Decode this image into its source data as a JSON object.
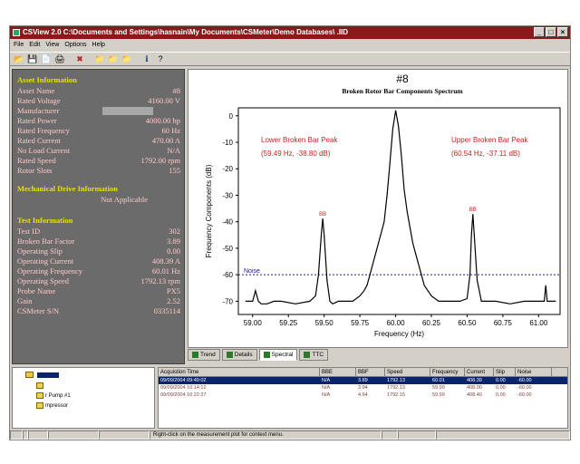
{
  "window": {
    "title": "CSView 2.0  C:\\Documents and Settings\\hasnain\\My Documents\\CSMeter\\Demo Databases\\        .IID",
    "buttons": [
      "_",
      "□",
      "×"
    ]
  },
  "menu": [
    "File",
    "Edit",
    "View",
    "Options",
    "Help"
  ],
  "toolbar": {
    "icons": [
      "open-folder-icon",
      "save-icon",
      "copy-icon",
      "print-icon",
      "delete-icon",
      "folder-yellow-icon",
      "folder-purple-icon",
      "folder-dark-icon",
      "info-icon",
      "help-icon"
    ],
    "glyphs": [
      "📂",
      "💾",
      "📄",
      "🖨",
      "✖",
      "📁",
      "📁",
      "📁",
      "ℹ",
      "?"
    ]
  },
  "asset": {
    "heading": "Asset Information",
    "rows": [
      {
        "label": "Asset Name",
        "value": "#8"
      },
      {
        "label": "Rated Voltage",
        "value": "4160.00 V"
      },
      {
        "label": "Manufacturer",
        "value": ""
      },
      {
        "label": "Rated Power",
        "value": "4000.00 hp"
      },
      {
        "label": "Rated Frequency",
        "value": "60 Hz"
      },
      {
        "label": "Rated Current",
        "value": "470.00 A"
      },
      {
        "label": "No Load Current",
        "value": "N/A"
      },
      {
        "label": "Rated Speed",
        "value": "1792.00 rpm"
      },
      {
        "label": "Rotor Slots",
        "value": "155"
      }
    ]
  },
  "drive": {
    "heading": "Mechanical Drive Information",
    "value": "Not Applicable"
  },
  "test": {
    "heading": "Test Information",
    "rows": [
      {
        "label": "Test ID",
        "value": "302"
      },
      {
        "label": "Broken Bar Factor",
        "value": "3.89"
      },
      {
        "label": "Operating Slip",
        "value": "0.00"
      },
      {
        "label": "Operating Current",
        "value": "408.39 A"
      },
      {
        "label": "Operating Frequency",
        "value": "60.01 Hz"
      },
      {
        "label": "Operating Speed",
        "value": "1792.13 rpm"
      },
      {
        "label": "Probe Name",
        "value": "PX5"
      },
      {
        "label": "Gain",
        "value": "2.52"
      },
      {
        "label": "CSMeter S/N",
        "value": "0335114"
      }
    ]
  },
  "chart_data": {
    "type": "line",
    "title": "#8",
    "subtitle": "Broken Rotor Bar Components Spectrum",
    "xlabel": "Frequency (Hz)",
    "ylabel": "Frequency Components (dB)",
    "xlim": [
      58.9,
      61.15
    ],
    "ylim": [
      -75,
      3
    ],
    "xticks": [
      59.0,
      59.25,
      59.5,
      59.75,
      60.0,
      60.25,
      60.5,
      60.75,
      61.0
    ],
    "xtick_labels": [
      "59.00",
      "59.25",
      "59.50",
      "59.75",
      "60.00",
      "60.25",
      "60.50",
      "60.75",
      "61.00"
    ],
    "yticks": [
      0,
      -10,
      -20,
      -30,
      -40,
      -50,
      -60,
      -70
    ],
    "grid": false,
    "noise": {
      "label": "Noise",
      "value": -60,
      "color": "#1a1aa0"
    },
    "annotations": [
      {
        "label": "Lower Broken Bar Peak",
        "detail": "(59.49 Hz, -38.80 dB)"
      },
      {
        "label": "Upper Broken Bar Peak",
        "detail": "(60.54 Hz, -37.11 dB)"
      }
    ],
    "peak_markers": [
      {
        "label": "BB",
        "x": 59.49,
        "y": -38.8
      },
      {
        "label": "BB",
        "x": 60.54,
        "y": -37.11
      }
    ],
    "label_color": "#cc2020",
    "series": [
      {
        "x": [
          58.95,
          59.0,
          59.02,
          59.04,
          59.06,
          59.1,
          59.15,
          59.2,
          59.3,
          59.4,
          59.44,
          59.46,
          59.48,
          59.49,
          59.5,
          59.52,
          59.54,
          59.56,
          59.6,
          59.65,
          59.7,
          59.75,
          59.78,
          59.8,
          59.82,
          59.84,
          59.86,
          59.88,
          59.9,
          59.92,
          59.94,
          59.96,
          59.98,
          60.0,
          60.02,
          60.04,
          60.06,
          60.08,
          60.1,
          60.12,
          60.14,
          60.16,
          60.18,
          60.2,
          60.25,
          60.3,
          60.35,
          60.4,
          60.45,
          60.5,
          60.52,
          60.53,
          60.54,
          60.55,
          60.57,
          60.6,
          60.65,
          60.7,
          60.8,
          60.9,
          61.0,
          61.04,
          61.05,
          61.06,
          61.1,
          61.12
        ],
        "y": [
          -70,
          -70,
          -66,
          -70,
          -71,
          -71,
          -70,
          -70,
          -71,
          -70,
          -68,
          -60,
          -45,
          -38.8,
          -45,
          -62,
          -70,
          -71,
          -70,
          -70,
          -70,
          -68,
          -66,
          -64,
          -60,
          -56,
          -52,
          -48,
          -44,
          -40,
          -30,
          -18,
          -5,
          2,
          -4,
          -15,
          -28,
          -36,
          -42,
          -48,
          -52,
          -56,
          -60,
          -64,
          -68,
          -70,
          -70,
          -70,
          -70,
          -69,
          -60,
          -45,
          -37.11,
          -45,
          -62,
          -70,
          -70,
          -70,
          -71,
          -70,
          -70,
          -70,
          -64,
          -70,
          -70,
          -70
        ]
      }
    ]
  },
  "tabs": [
    {
      "label": "Trend",
      "active": false
    },
    {
      "label": "Details",
      "active": false
    },
    {
      "label": "Spectral",
      "active": true
    },
    {
      "label": "TTC",
      "active": false
    }
  ],
  "tree": {
    "items": [
      {
        "label": "",
        "icon": "folder-icon"
      },
      {
        "label": "",
        "icon": "motor-icon"
      },
      {
        "label": "r Pump #1",
        "icon": "motor-icon"
      },
      {
        "label": "mpressor",
        "icon": "motor-icon"
      }
    ]
  },
  "table": {
    "columns": [
      "Acquistion Time",
      "BBE",
      "BBF",
      "Speed",
      "Frequency",
      "Current",
      "Slip",
      "Noise"
    ],
    "rows": [
      [
        "09/09/2004 09:49:02",
        "N/A",
        "3.89",
        "1792.13",
        "60.01",
        "408.39",
        "0.00",
        "-60.00"
      ],
      [
        "09/09/2004 10:14:12",
        "N/A",
        "3.94",
        "1792.13",
        "59.99",
        "408.00",
        "0.00",
        "-60.00"
      ],
      [
        "09/09/2004 10:22:27",
        "N/A",
        "4.64",
        "1792.15",
        "59.99",
        "408.40",
        "0.00",
        "-60.00"
      ]
    ],
    "selected": 0
  },
  "status": {
    "message": "Right-click on the measurement plot for context menu."
  }
}
